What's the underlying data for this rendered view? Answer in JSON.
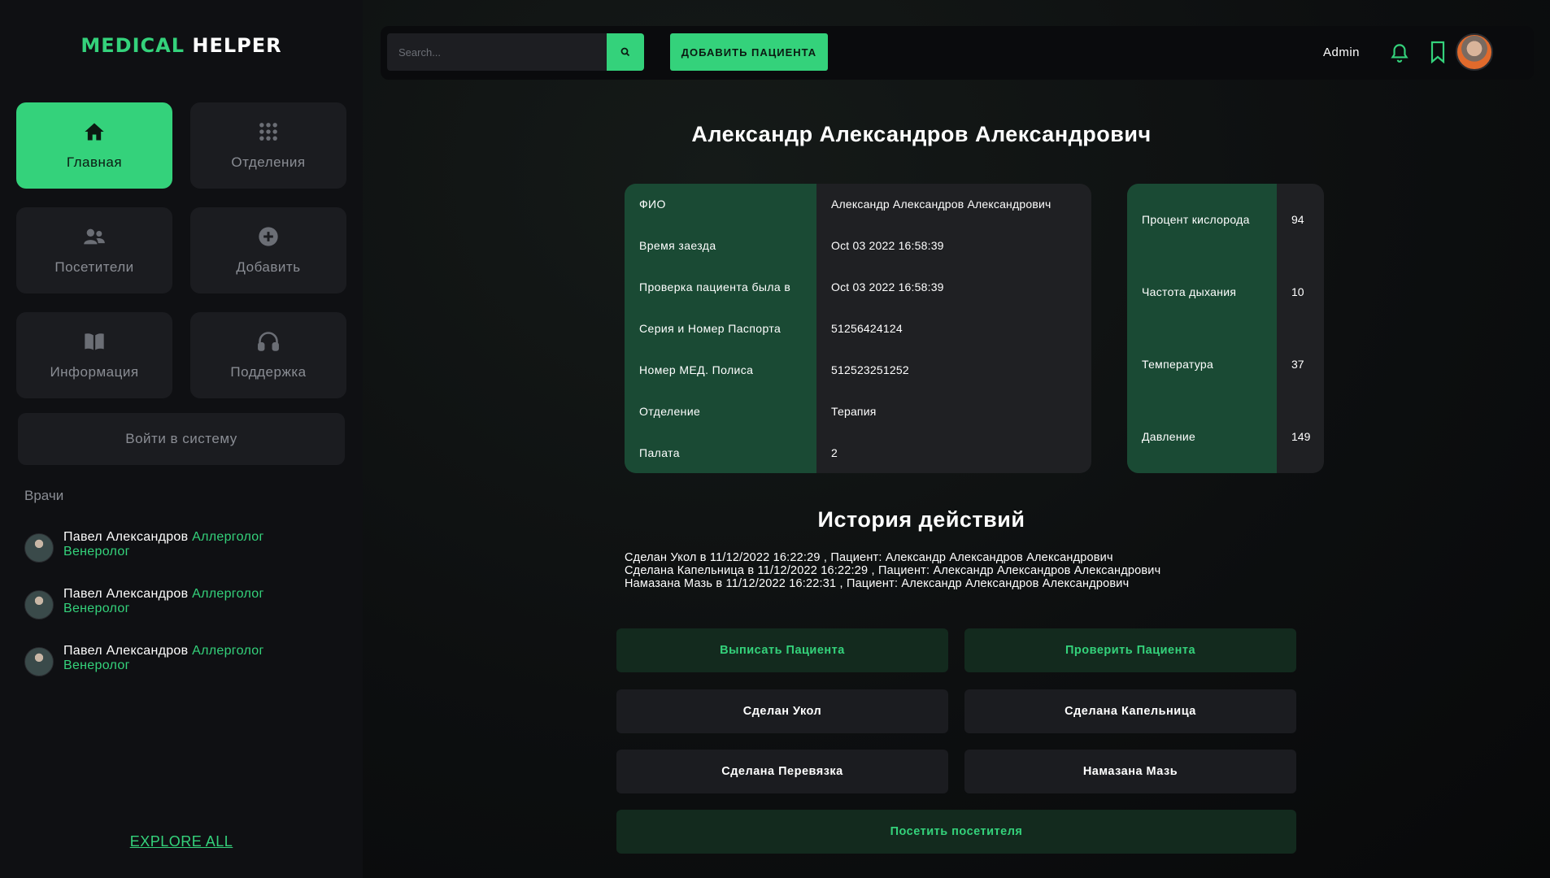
{
  "logo": {
    "part1": "MEDICAL",
    "part2": "HELPER"
  },
  "sidebar": {
    "tiles": [
      {
        "label": "Главная",
        "icon": "home-icon",
        "active": true
      },
      {
        "label": "Отделения",
        "icon": "grid-icon",
        "active": false
      },
      {
        "label": "Посетители",
        "icon": "users-icon",
        "active": false
      },
      {
        "label": "Добавить",
        "icon": "plus-circle-icon",
        "active": false
      },
      {
        "label": "Информация",
        "icon": "book-icon",
        "active": false
      },
      {
        "label": "Поддержка",
        "icon": "headphones-icon",
        "active": false
      }
    ],
    "login_label": "Войти в систему",
    "doctors_title": "Врачи",
    "doctors": [
      {
        "name": "Павел Александров",
        "spec1": "Аллерголог",
        "spec2": "Венеролог"
      },
      {
        "name": "Павел Александров",
        "spec1": "Аллерголог",
        "spec2": "Венеролог"
      },
      {
        "name": "Павел Александров",
        "spec1": "Аллерголог",
        "spec2": "Венеролог"
      }
    ],
    "explore_label": "EXPLORE ALL"
  },
  "topbar": {
    "search_placeholder": "Search...",
    "add_patient_label": "ДОБАВИТЬ ПАЦИЕНТА",
    "admin_label": "Admin"
  },
  "patient": {
    "title": "Александр Александров Александрович",
    "info": [
      {
        "label": "ФИО",
        "value": "Александр Александров Александрович"
      },
      {
        "label": "Время заезда",
        "value": "Oct 03 2022 16:58:39"
      },
      {
        "label": "Проверка пациента была в",
        "value": "Oct 03 2022 16:58:39"
      },
      {
        "label": "Серия и Номер Паспорта",
        "value": "51256424124"
      },
      {
        "label": "Номер МЕД. Полиса",
        "value": "512523251252"
      },
      {
        "label": "Отделение",
        "value": "Терапия"
      },
      {
        "label": "Палата",
        "value": "2"
      }
    ],
    "vitals": [
      {
        "label": "Процент кислорода",
        "value": "94"
      },
      {
        "label": "Частота дыхания",
        "value": "10"
      },
      {
        "label": "Температура",
        "value": "37"
      },
      {
        "label": "Давление",
        "value": "149"
      }
    ]
  },
  "history": {
    "title": "История действий",
    "lines": [
      "Сделан Укол в 11/12/2022 16:22:29 , Пациент: Александр Александров Александрович",
      "Сделана Капельница в 11/12/2022 16:22:29 , Пациент: Александр Александров Александрович",
      "Намазана Мазь в 11/12/2022 16:22:31 , Пациент: Александр Александров Александрович"
    ]
  },
  "actions": {
    "discharge": "Выписать Пациента",
    "check": "Проверить Пациента",
    "injection": "Сделан Укол",
    "drip": "Сделана Капельница",
    "bandage": "Сделана Перевязка",
    "ointment": "Намазана Мазь",
    "visit": "Посетить посетителя"
  },
  "colors": {
    "accent": "#34d27b",
    "panel": "#1a4a34",
    "card": "#1f2023",
    "tile": "#1b1c20"
  }
}
